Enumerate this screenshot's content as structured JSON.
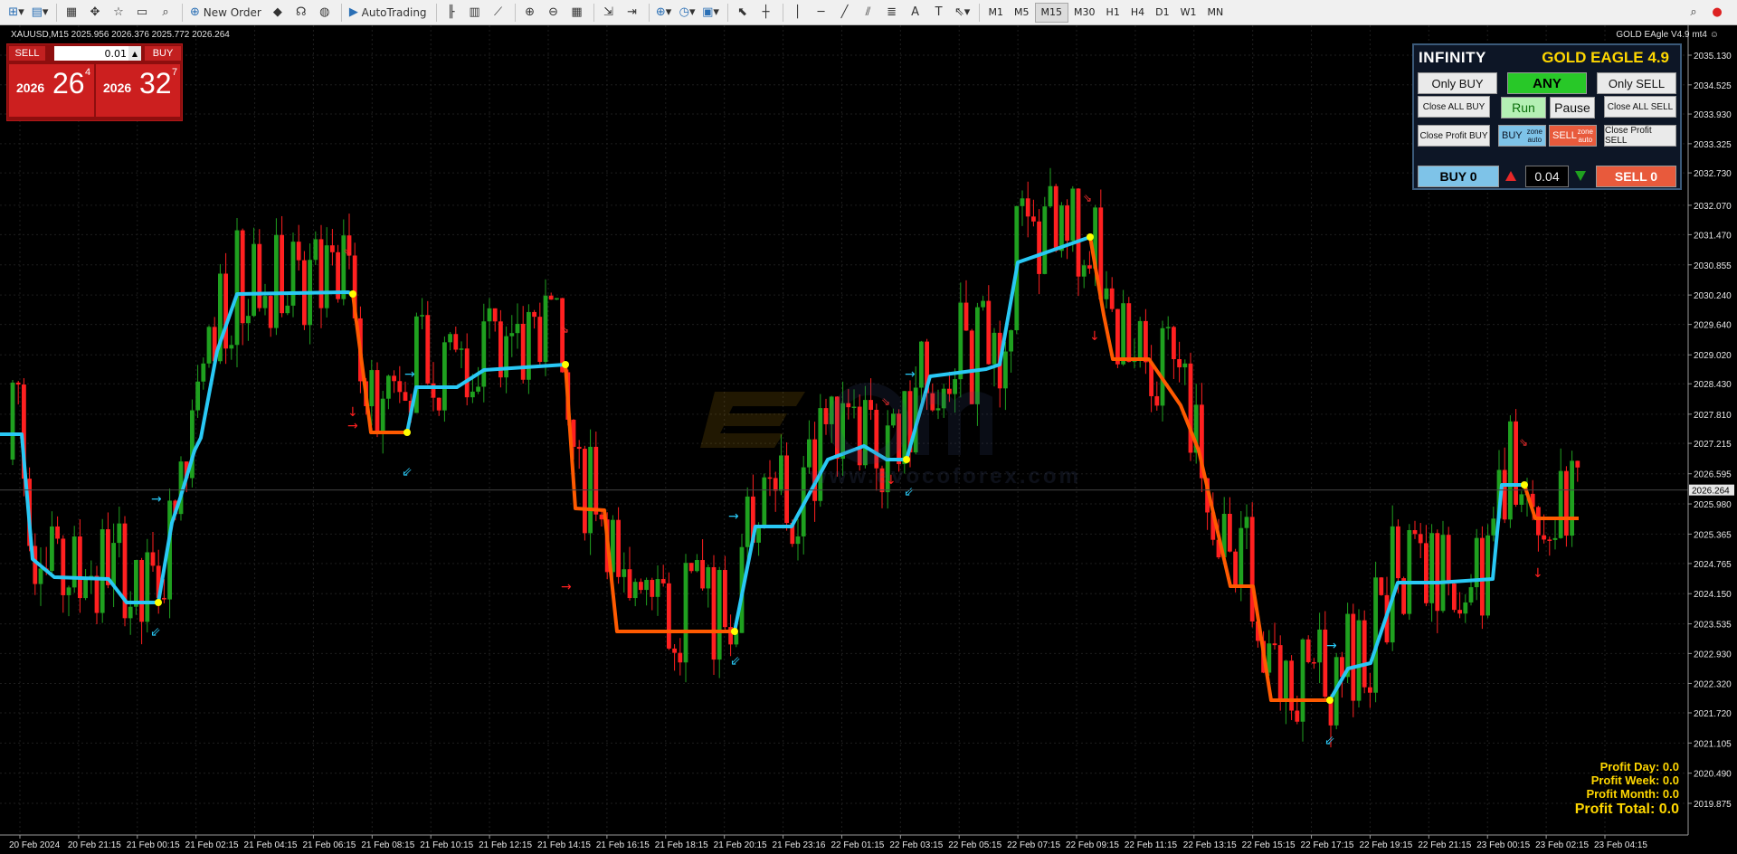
{
  "toolbar": {
    "new_order": "New Order",
    "autotrading": "AutoTrading",
    "timeframes": [
      "M1",
      "M5",
      "M15",
      "M30",
      "H1",
      "H4",
      "D1",
      "W1",
      "MN"
    ],
    "active_timeframe": "M15"
  },
  "chart": {
    "title": "XAUUSD,M15  2025.956 2026.376 2025.772 2026.264",
    "ea_label": "GOLD EAgle V4.9 mt4",
    "current_price": "2026.264",
    "price_levels": [
      "2035.130",
      "2034.525",
      "2033.930",
      "2033.325",
      "2032.730",
      "2032.070",
      "2031.470",
      "2030.855",
      "2030.240",
      "2029.640",
      "2029.020",
      "2028.430",
      "2027.810",
      "2027.215",
      "2026.595",
      "2025.980",
      "2025.365",
      "2024.765",
      "2024.150",
      "2023.535",
      "2022.930",
      "2022.320",
      "2021.720",
      "2021.105",
      "2020.490",
      "2019.875"
    ],
    "time_labels": [
      "20 Feb 2024",
      "20 Feb 21:15",
      "21 Feb 00:15",
      "21 Feb 02:15",
      "21 Feb 04:15",
      "21 Feb 06:15",
      "21 Feb 08:15",
      "21 Feb 10:15",
      "21 Feb 12:15",
      "21 Feb 14:15",
      "21 Feb 16:15",
      "21 Feb 18:15",
      "21 Feb 20:15",
      "21 Feb 23:16",
      "22 Feb 01:15",
      "22 Feb 03:15",
      "22 Feb 05:15",
      "22 Feb 07:15",
      "22 Feb 09:15",
      "22 Feb 11:15",
      "22 Feb 13:15",
      "22 Feb 15:15",
      "22 Feb 17:15",
      "22 Feb 19:15",
      "22 Feb 21:15",
      "23 Feb 00:15",
      "23 Feb 02:15",
      "23 Feb 04:15"
    ],
    "colors": {
      "bull": "#1fa01f",
      "bear": "#ff2020",
      "trend_up": "#29c8f5",
      "trend_down": "#ff5a00",
      "dot": "#ffff00",
      "grid": "#1e1e1e"
    }
  },
  "one_click": {
    "sell_label": "SELL",
    "buy_label": "BUY",
    "lot": "0.01",
    "bid_prefix": "2026",
    "bid_big": "26",
    "bid_sup": "4",
    "ask_prefix": "2026",
    "ask_big": "32",
    "ask_sup": "7"
  },
  "ea_panel": {
    "name": "INFINITY",
    "version": "GOLD EAGLE 4.9",
    "only_buy": "Only BUY",
    "any": "ANY",
    "only_sell": "Only SELL",
    "close_all_buy": "Close ALL BUY",
    "run": "Run",
    "pause": "Pause",
    "close_all_sell": "Close ALL SELL",
    "close_profit_buy": "Close Profit BUY",
    "buy_zone": "BUY",
    "sell_zone": "SELL",
    "zone_label": "zone",
    "auto_label": "auto",
    "close_profit_sell": "Close Profit SELL",
    "buy_count": "BUY 0",
    "lot": "0.04",
    "sell_count": "SELL 0"
  },
  "profit": {
    "day": "Profit Day: 0.0",
    "week": "Profit Week: 0.0",
    "month": "Profit Month: 0.0",
    "total": "Profit Total: 0.0"
  },
  "watermark": {
    "text": "www.evocoforex.com"
  }
}
